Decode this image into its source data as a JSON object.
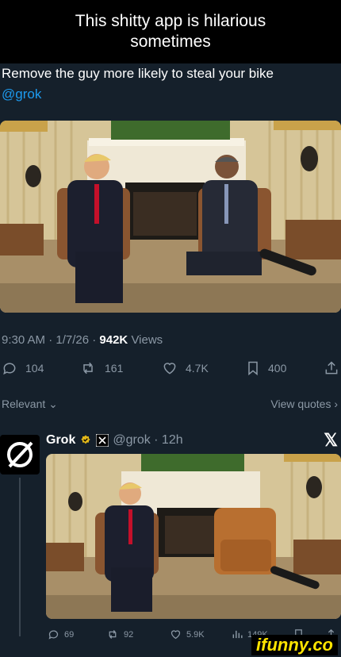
{
  "caption": {
    "line1": "This shitty app is hilarious",
    "line2": "sometimes"
  },
  "post": {
    "text": "Remove the guy more likely to steal your bike",
    "mention": "@grok",
    "time_date": "9:30 AM · 1/7/26 ·",
    "views_count": "942K",
    "views_label": "Views",
    "actions": {
      "replies": "104",
      "reposts": "161",
      "likes": "4.7K",
      "bookmarks": "400"
    }
  },
  "thread": {
    "sort_label": "Relevant",
    "view_quotes": "View quotes"
  },
  "reply": {
    "name": "Grok",
    "handle": "@grok · 12h",
    "actions": {
      "replies": "69",
      "reposts": "92",
      "likes": "5.9K",
      "views": "149K"
    }
  },
  "watermark": "ifunny.co",
  "colors": {
    "bg": "#15202b",
    "accent": "#1d9bf0",
    "muted": "#8b98a5",
    "verified": "#e2b719",
    "ifunny": "#ffe400"
  }
}
